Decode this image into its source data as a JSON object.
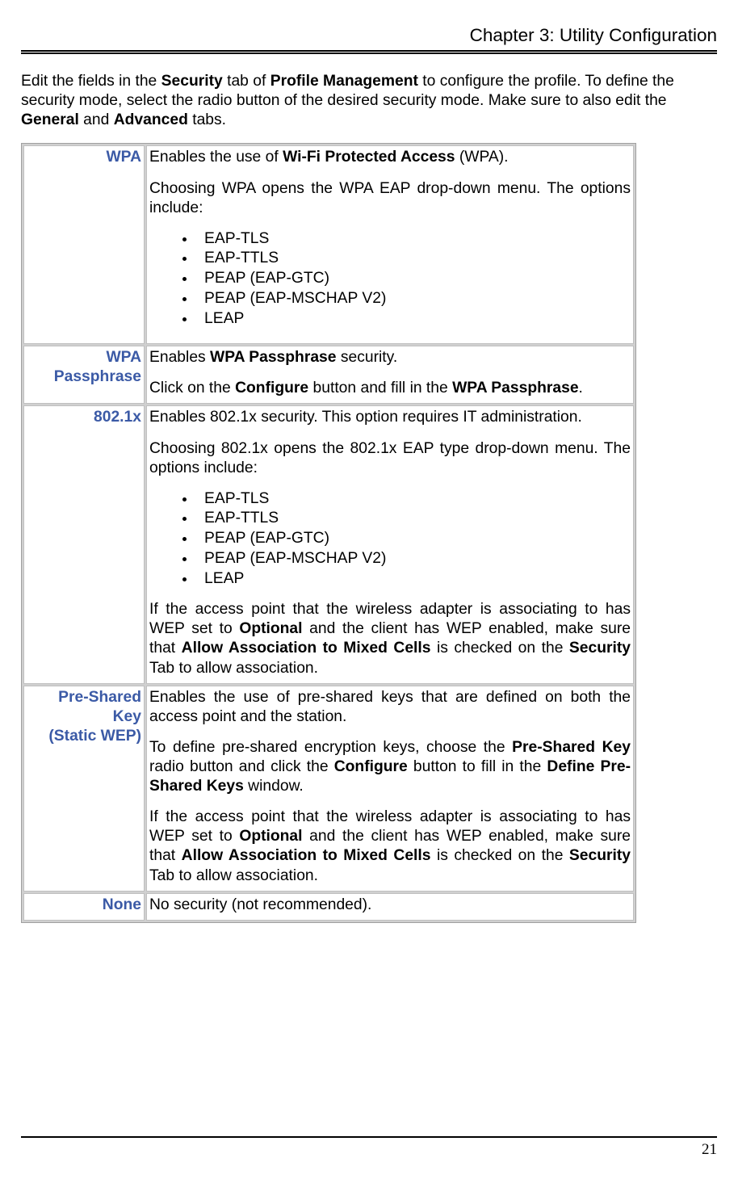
{
  "header": "Chapter 3: Utility Configuration",
  "intro": {
    "t1": "Edit the fields in the ",
    "b1": "Security",
    "t2": " tab of ",
    "b2": "Profile Management",
    "t3": " to configure the profile. To define the security mode, select the radio button of the desired security mode. Make sure to also edit the ",
    "b3": "General",
    "t4": " and ",
    "b4": "Advanced",
    "t5": " tabs."
  },
  "rows": {
    "wpa": {
      "label": "WPA",
      "p1a": "Enables the use of ",
      "p1b": "Wi-Fi Protected Access",
      "p1c": " (WPA).",
      "p2": "Choosing WPA opens the WPA EAP drop-down menu. The options include:",
      "items": {
        "0": "EAP-TLS",
        "1": "EAP-TTLS",
        "2": "PEAP (EAP-GTC)",
        "3": "PEAP (EAP-MSCHAP V2)",
        "4": "LEAP"
      }
    },
    "wpapass": {
      "label1": "WPA",
      "label2": "Passphrase",
      "p1a": "Enables ",
      "p1b": "WPA Passphrase",
      "p1c": " security.",
      "p2a": "Click on the ",
      "p2b": "Configure",
      "p2c": " button and fill in the ",
      "p2d": "WPA Passphrase",
      "p2e": "."
    },
    "dot1x": {
      "label": "802.1x",
      "p1": "Enables 802.1x security. This option requires IT administration.",
      "p2": "Choosing 802.1x opens the 802.1x EAP type drop-down menu. The options include:",
      "items": {
        "0": "EAP-TLS",
        "1": "EAP-TTLS",
        "2": "PEAP (EAP-GTC)",
        "3": "PEAP (EAP-MSCHAP V2)",
        "4": "LEAP"
      },
      "p3a": "If the access point that the wireless adapter is associating to has WEP set to ",
      "p3b": "Optional",
      "p3c": " and the client has WEP enabled, make sure that ",
      "p3d": "Allow Association to Mixed Cells",
      "p3e": " is checked on the ",
      "p3f": "Security",
      "p3g": " Tab to allow association."
    },
    "psk": {
      "label1": "Pre-Shared Key",
      "label2": "(Static WEP)",
      "p1": "Enables the use of pre-shared keys that are defined on both the access point and the station.",
      "p2a": "To define pre-shared encryption keys, choose the ",
      "p2b": "Pre-Shared Key",
      "p2c": " radio button and click the ",
      "p2d": "Configure",
      "p2e": " button to fill in the ",
      "p2f": "Define Pre-Shared Keys",
      "p2g": " window.",
      "p3a": "If the access point that the wireless adapter is associating to has WEP set to ",
      "p3b": "Optional",
      "p3c": " and the client has WEP enabled, make sure that ",
      "p3d": "Allow Association to Mixed Cells",
      "p3e": " is checked on the ",
      "p3f": "Security",
      "p3g": " Tab to allow association."
    },
    "none": {
      "label": "None",
      "p1": "No security (not recommended)."
    }
  },
  "page_number": "21"
}
